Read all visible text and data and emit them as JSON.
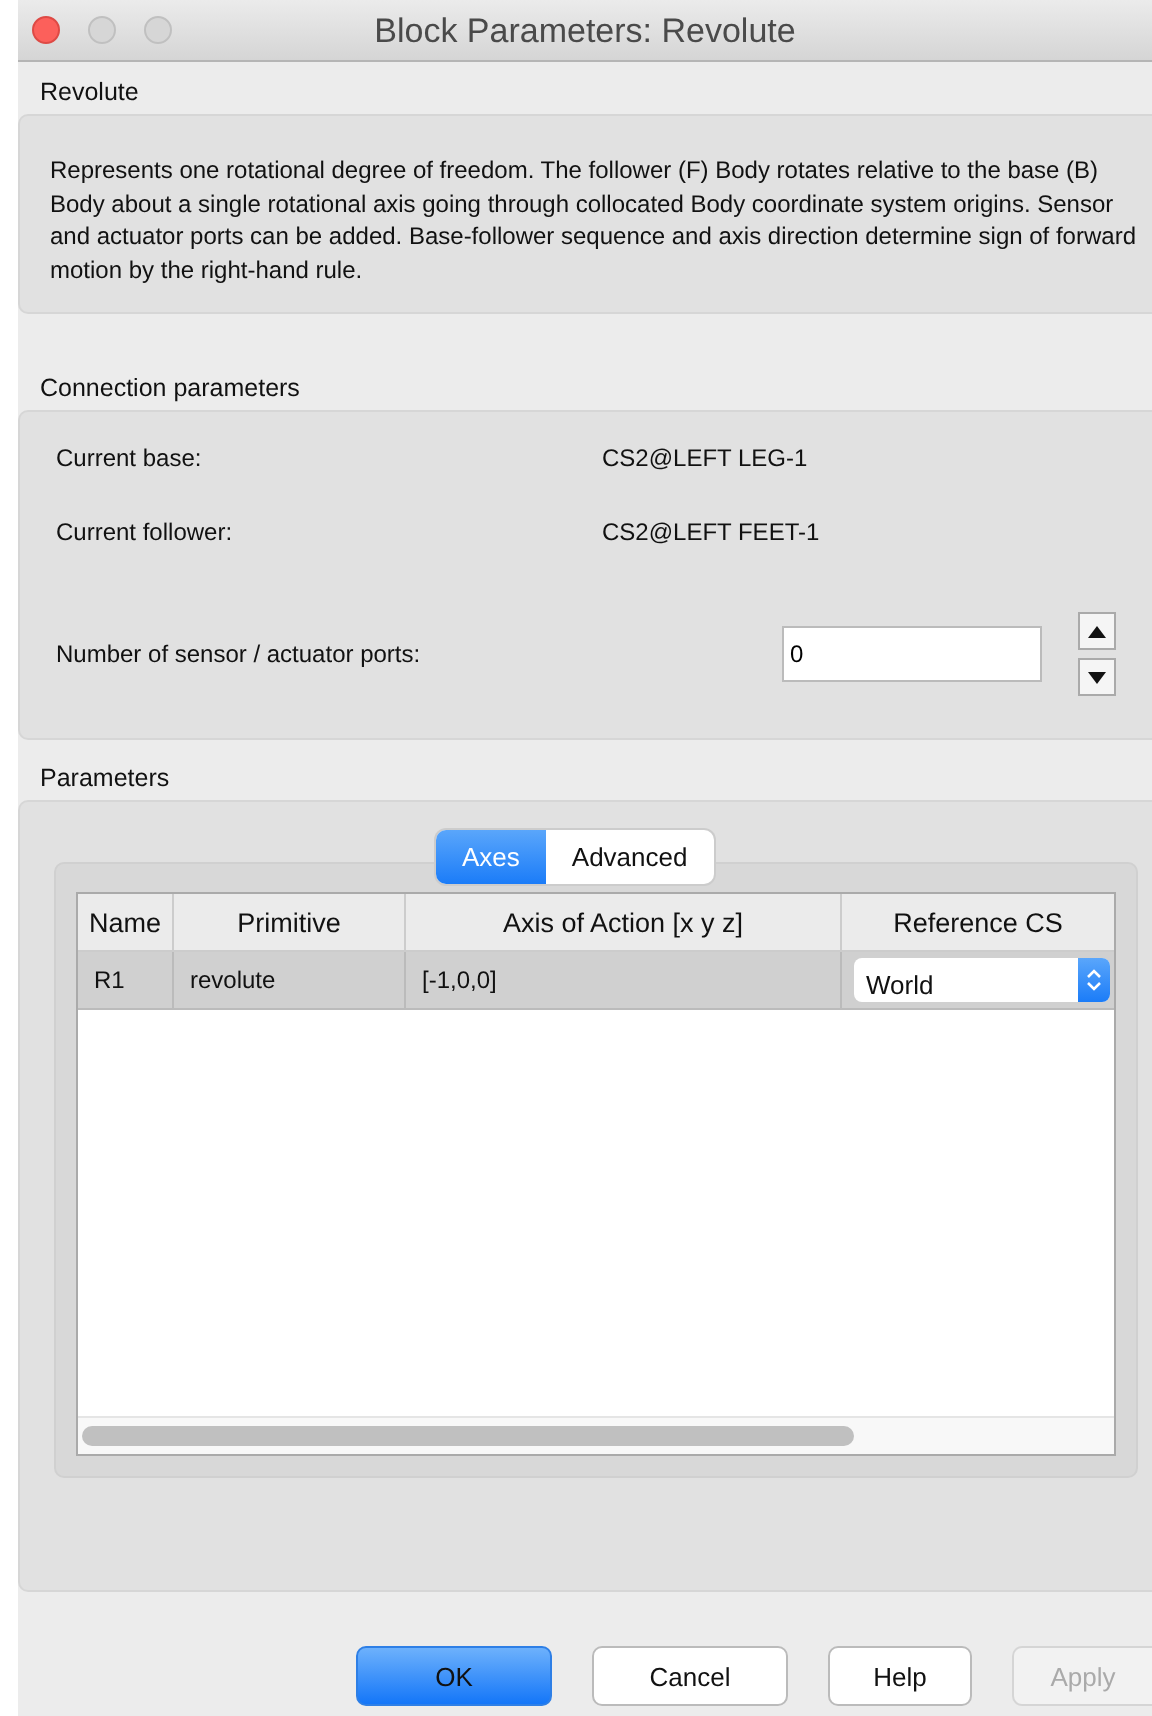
{
  "window": {
    "title": "Block Parameters: Revolute"
  },
  "block": {
    "heading": "Revolute",
    "description": "Represents one rotational degree of freedom. The follower (F) Body rotates relative to the base (B) Body about a single rotational axis going through collocated Body coordinate system origins. Sensor and actuator ports can be added. Base-follower sequence and axis direction determine sign of forward motion by the right-hand rule."
  },
  "connection": {
    "heading": "Connection parameters",
    "rows": [
      {
        "label": "Current base:",
        "value": "CS2@LEFT LEG-1"
      },
      {
        "label": "Current follower:",
        "value": "CS2@LEFT FEET-1"
      }
    ],
    "ports": {
      "label": "Number of sensor / actuator ports:",
      "value": "0"
    }
  },
  "parameters": {
    "heading": "Parameters",
    "tabs": [
      {
        "label": "Axes",
        "selected": true
      },
      {
        "label": "Advanced",
        "selected": false
      }
    ],
    "table": {
      "columns": [
        "Name",
        "Primitive",
        "Axis of Action [x y z]",
        "Reference CS"
      ],
      "rows": [
        {
          "name": "R1",
          "primitive": "revolute",
          "axis": "[-1,0,0]",
          "reference": "World",
          "selected": true
        }
      ]
    }
  },
  "buttons": [
    {
      "label": "OK",
      "kind": "default",
      "disabled": false
    },
    {
      "label": "Cancel",
      "kind": "normal",
      "disabled": false
    },
    {
      "label": "Help",
      "kind": "normal",
      "disabled": false
    },
    {
      "label": "Apply",
      "kind": "normal",
      "disabled": true
    }
  ]
}
